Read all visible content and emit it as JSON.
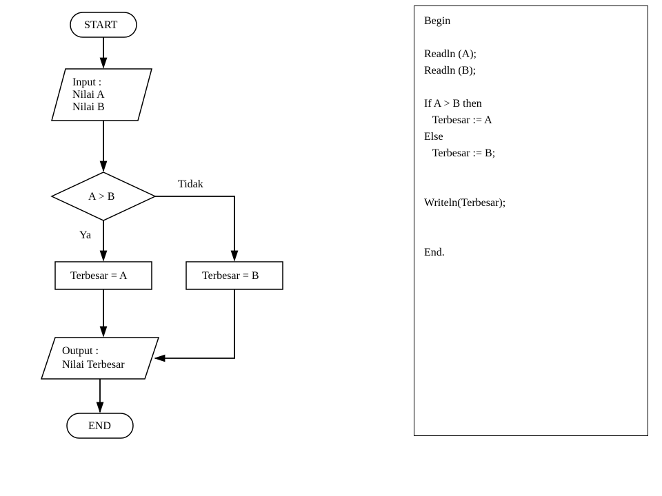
{
  "flowchart": {
    "start": "START",
    "input_line1": "Input :",
    "input_line2": "Nilai A",
    "input_line3": "Nilai B",
    "decision": "A > B",
    "label_yes": "Ya",
    "label_no": "Tidak",
    "process_a": "Terbesar = A",
    "process_b": "Terbesar = B",
    "output_line1": "Output :",
    "output_line2": "Nilai Terbesar",
    "end": "END"
  },
  "code": {
    "l1": "Begin",
    "l2": "",
    "l3": "Readln (A);",
    "l4": "Readln (B);",
    "l5": "",
    "l6": "If A > B then",
    "l7": "   Terbesar := A",
    "l8": "Else",
    "l9": "   Terbesar := B;",
    "l10": "",
    "l11": "",
    "l12": "Writeln(Terbesar);",
    "l13": "",
    "l14": "",
    "l15": "End."
  }
}
